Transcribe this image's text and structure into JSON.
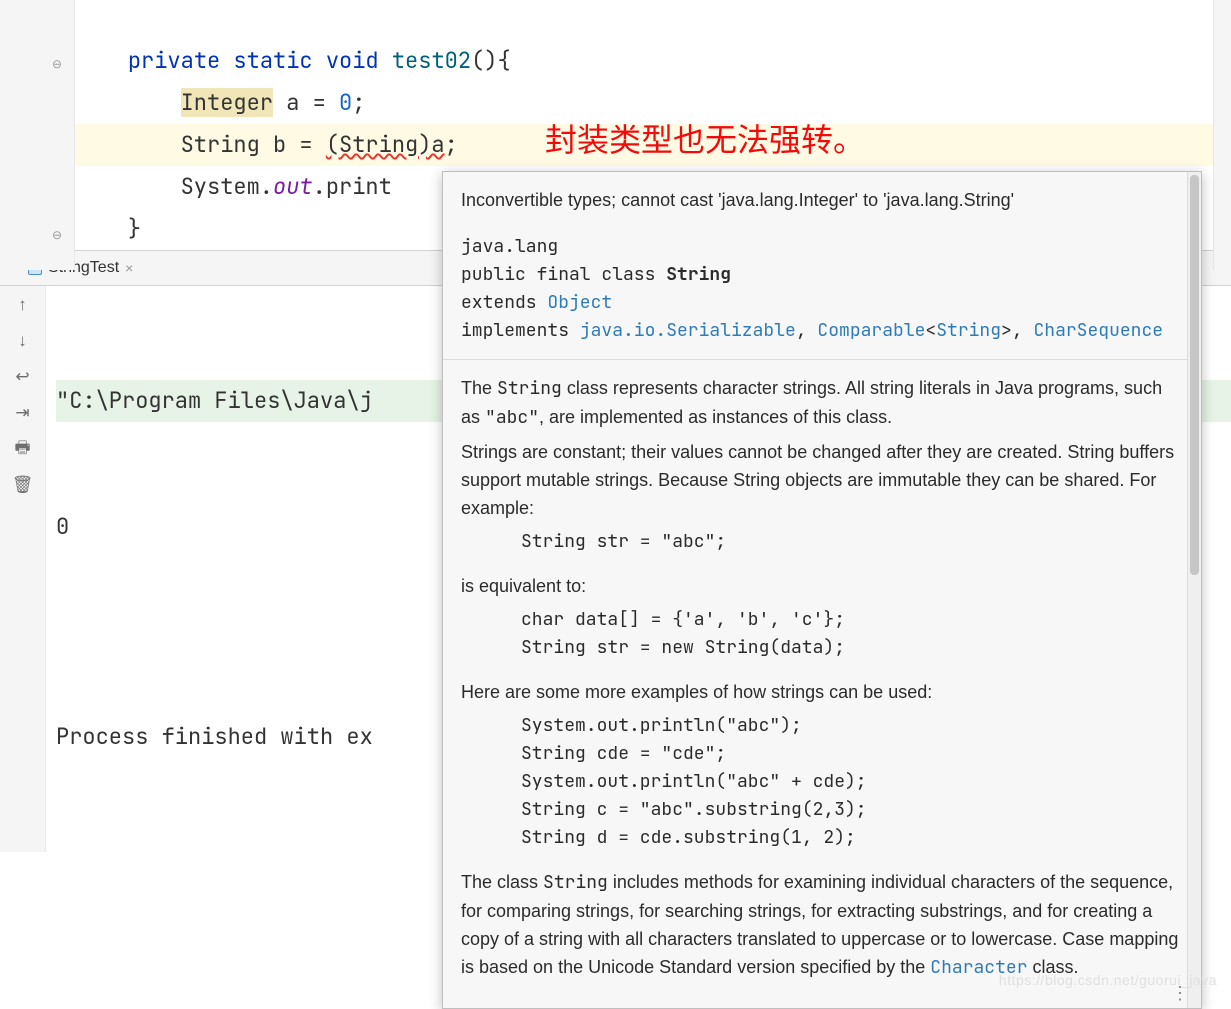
{
  "code": {
    "indent1": "    ",
    "indent2": "        ",
    "kw_private": "private",
    "kw_static": "static",
    "kw_void": "void",
    "fn_name": "test02",
    "sig_tail": "(){",
    "type_integer": "Integer",
    "intline_tail": " a = ",
    "int_zero": "0",
    "semi": ";",
    "str_type": "String",
    "strline_mid": " b = ",
    "cast": "(String)a",
    "sys": "System.",
    "out": "out",
    "println": ".print",
    "brace_close": "}"
  },
  "annotation": "封装类型也无法强转。",
  "tab": {
    "name": "StringTest"
  },
  "console": {
    "line1": "\"C:\\Program Files\\Java\\j",
    "line2": "0",
    "line3": "",
    "line4": "Process finished with ex"
  },
  "doc": {
    "error": "Inconvertible types; cannot cast 'java.lang.Integer' to 'java.lang.String'",
    "sig": {
      "pkg": "java.lang",
      "mods": "public final class ",
      "name": "String",
      "ext": "extends ",
      "object": "Object",
      "impl": "implements ",
      "ser": "java.io.Serializable",
      "comp1": "Comparable",
      "lt": "<",
      "str": "String",
      "gt": ">",
      "charseq": "CharSequence"
    },
    "p1_a": "The ",
    "p1_string": "String",
    "p1_b": " class represents character strings. All string literals in Java programs, such as ",
    "p1_abc": "\"abc\"",
    "p1_c": ", are implemented as instances of this class.",
    "p2": "Strings are constant; their values cannot be changed after they are created. String buffers support mutable strings. Because String objects are immutable they can be shared. For example:",
    "code1": "String str = \"abc\";",
    "equiv": "is equivalent to:",
    "code2": "char data[] = {'a', 'b', 'c'};\nString str = new String(data);",
    "examples_intro": "Here are some more examples of how strings can be used:",
    "code3": "System.out.println(\"abc\");\nString cde = \"cde\";\nSystem.out.println(\"abc\" + cde);\nString c = \"abc\".substring(2,3);\nString d = cde.substring(1, 2);",
    "p3_a": "The class ",
    "p3_string": "String",
    "p3_b": " includes methods for examining individual characters of the sequence, for comparing strings, for searching strings, for extracting substrings, and for creating a copy of a string with all characters translated to uppercase or to lowercase. Case mapping is based on the Unicode Standard version specified by the ",
    "p3_char": "Character",
    "p3_c": " class."
  },
  "icons": {
    "fold_open": "⊖",
    "up": "↑",
    "down": "↓",
    "wrap": "↩",
    "scroll": "⇥",
    "print": "🖶",
    "trash": "🗑",
    "dots": "⋮"
  },
  "watermark": "https://blog.csdn.net/guorui_java"
}
